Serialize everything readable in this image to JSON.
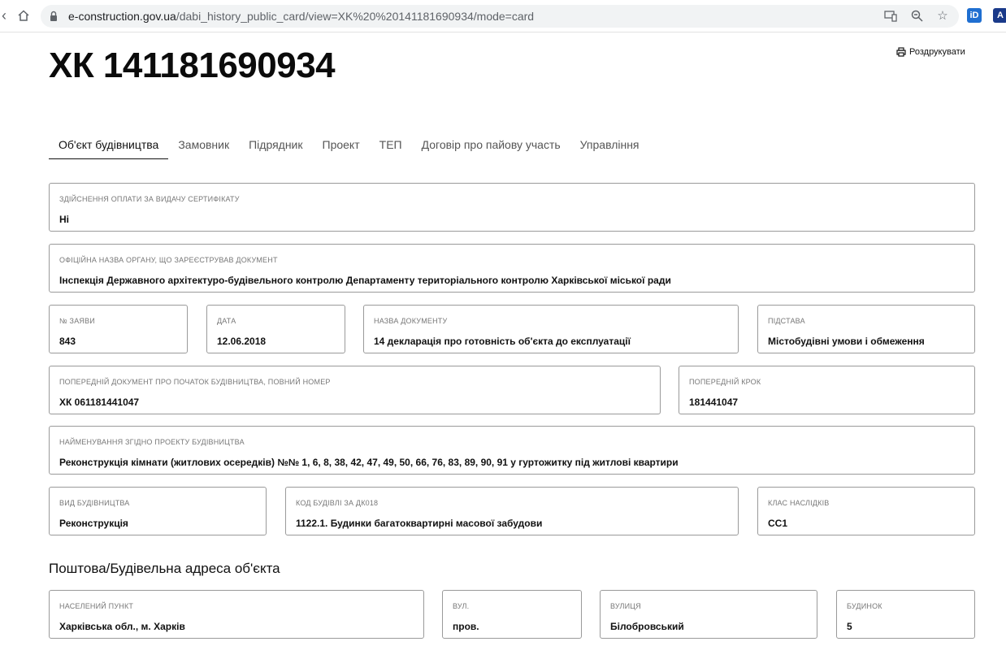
{
  "browser": {
    "url_host": "e-construction.gov.ua",
    "url_path": "/dabi_history_public_card/view=XK%20%20141181690934/mode=card",
    "ext1": "iD"
  },
  "page": {
    "doc_number": "ХК 141181690934",
    "print_label": "Роздрукувати"
  },
  "tabs": [
    {
      "label": "Об'єкт будівництва"
    },
    {
      "label": "Замовник"
    },
    {
      "label": "Підрядник"
    },
    {
      "label": "Проект"
    },
    {
      "label": "ТЕП"
    },
    {
      "label": "Договір про пайову участь"
    },
    {
      "label": "Управління"
    }
  ],
  "fields": {
    "payment": {
      "label": "Здійснення оплати за видачу сертифікату",
      "value": "Ні"
    },
    "authority": {
      "label": "Офіційна назва органу, що зареєстрував документ",
      "value": "Інспекція Державного архітектуро-будівельного контролю Департаменту територіального контролю Харківської міської ради"
    },
    "app_no": {
      "label": "№ заяви",
      "value": "843"
    },
    "date": {
      "label": "Дата",
      "value": "12.06.2018"
    },
    "doc_name": {
      "label": "Назва документу",
      "value": "14 декларація про готовність об'єкта до експлуатації"
    },
    "basis": {
      "label": "Підстава",
      "value": "Містобудівні умови і обмеження"
    },
    "prev_doc": {
      "label": "Попередній документ про початок будівництва, повний номер",
      "value": "ХК 061181441047"
    },
    "prev_step": {
      "label": "Попередній крок",
      "value": "181441047"
    },
    "project_name": {
      "label": "Найменування згідно проекту будівництва",
      "value": "Реконструкція кімнати (житлових осередків) №№ 1, 6, 8, 38, 42, 47, 49, 50, 66, 76, 83, 89, 90, 91 у гуртожитку під житлові квартири"
    },
    "construction_type": {
      "label": "Вид будівництва",
      "value": "Реконструкція"
    },
    "building_code": {
      "label": "Код будівлі за ДК018",
      "value": "1122.1. Будинки багатоквартирні масової забудови"
    },
    "consequence_class": {
      "label": "Клас наслідків",
      "value": "СС1"
    }
  },
  "address": {
    "title": "Поштова/Будівельна адреса об'єкта",
    "locality": {
      "label": "Населений пункт",
      "value": "Харківська обл., м. Харків"
    },
    "street_type": {
      "label": "Вул.",
      "value": "пров."
    },
    "street": {
      "label": "Вулиця",
      "value": "Білобровський"
    },
    "house": {
      "label": "Будинок",
      "value": "5"
    }
  }
}
